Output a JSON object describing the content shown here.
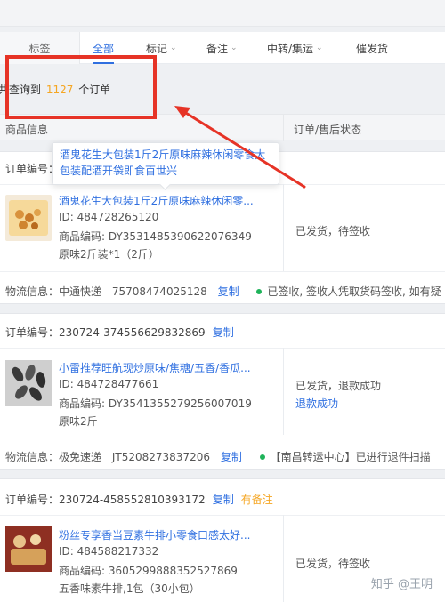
{
  "tabs": {
    "first": "标签",
    "all": "全部",
    "mark": "标记",
    "note": "备注",
    "transit": "中转/集运",
    "urge": "催发货"
  },
  "count_line": {
    "prefix": "共查询到",
    "count": "1127",
    "suffix": "个订单"
  },
  "table_header": {
    "product": "商品信息",
    "status": "订单/售后状态"
  },
  "tooltip_text": "酒鬼花生大包装1斤2斤原味麻辣休闲零食大包装配酒开袋即食百世兴",
  "orders": [
    {
      "order_label": "订单编号：",
      "order_no": "",
      "title": "酒鬼花生大包装1斤2斤原味麻辣休闲零...",
      "id_line": "ID: 484728265120",
      "code_line": "商品编码: DY3531485390622076349",
      "spec_line": "原味2斤装*1（2斤）",
      "status1": "已发货，待签收",
      "status2": "",
      "logistics_label": "物流信息：",
      "logistics_company": "中通快递",
      "tracking": "75708474025128",
      "copy": "复制",
      "tracking_status": "已签收, 签收人凭取货码签收, 如有疑"
    },
    {
      "order_label": "订单编号：",
      "order_no": "230724-374556629832869",
      "order_copy": "复制",
      "title": "小雷推荐旺航现炒原味/焦糖/五香/香瓜...",
      "id_line": "ID: 484728477661",
      "code_line": "商品编码: DY3541355279256007019",
      "spec_line": "原味2斤",
      "status1": "已发货，退款成功",
      "status2": "退款成功",
      "logistics_label": "物流信息：",
      "logistics_company": "极免速递",
      "tracking": "JT5208273837206",
      "copy": "复制",
      "tracking_status": "【南昌转运中心】已进行退件扫描"
    },
    {
      "order_label": "订单编号：",
      "order_no": "230724-458552810393172",
      "order_copy": "复制",
      "order_note": "有备注",
      "title": "粉丝专享香当豆素牛排小零食口感太好...",
      "id_line": "ID: 484588217332",
      "code_line": "商品编码: 3605299888352527869",
      "spec_line": "五香味素牛排,1包（30小包）",
      "status1": "已发货，待签收",
      "status2": ""
    }
  ],
  "watermark": "知乎 @王明",
  "colors": {
    "accent": "#2f6fe0",
    "highlight": "#f5a623",
    "annotation_red": "#e63326",
    "success_dot": "#1fb35a"
  }
}
